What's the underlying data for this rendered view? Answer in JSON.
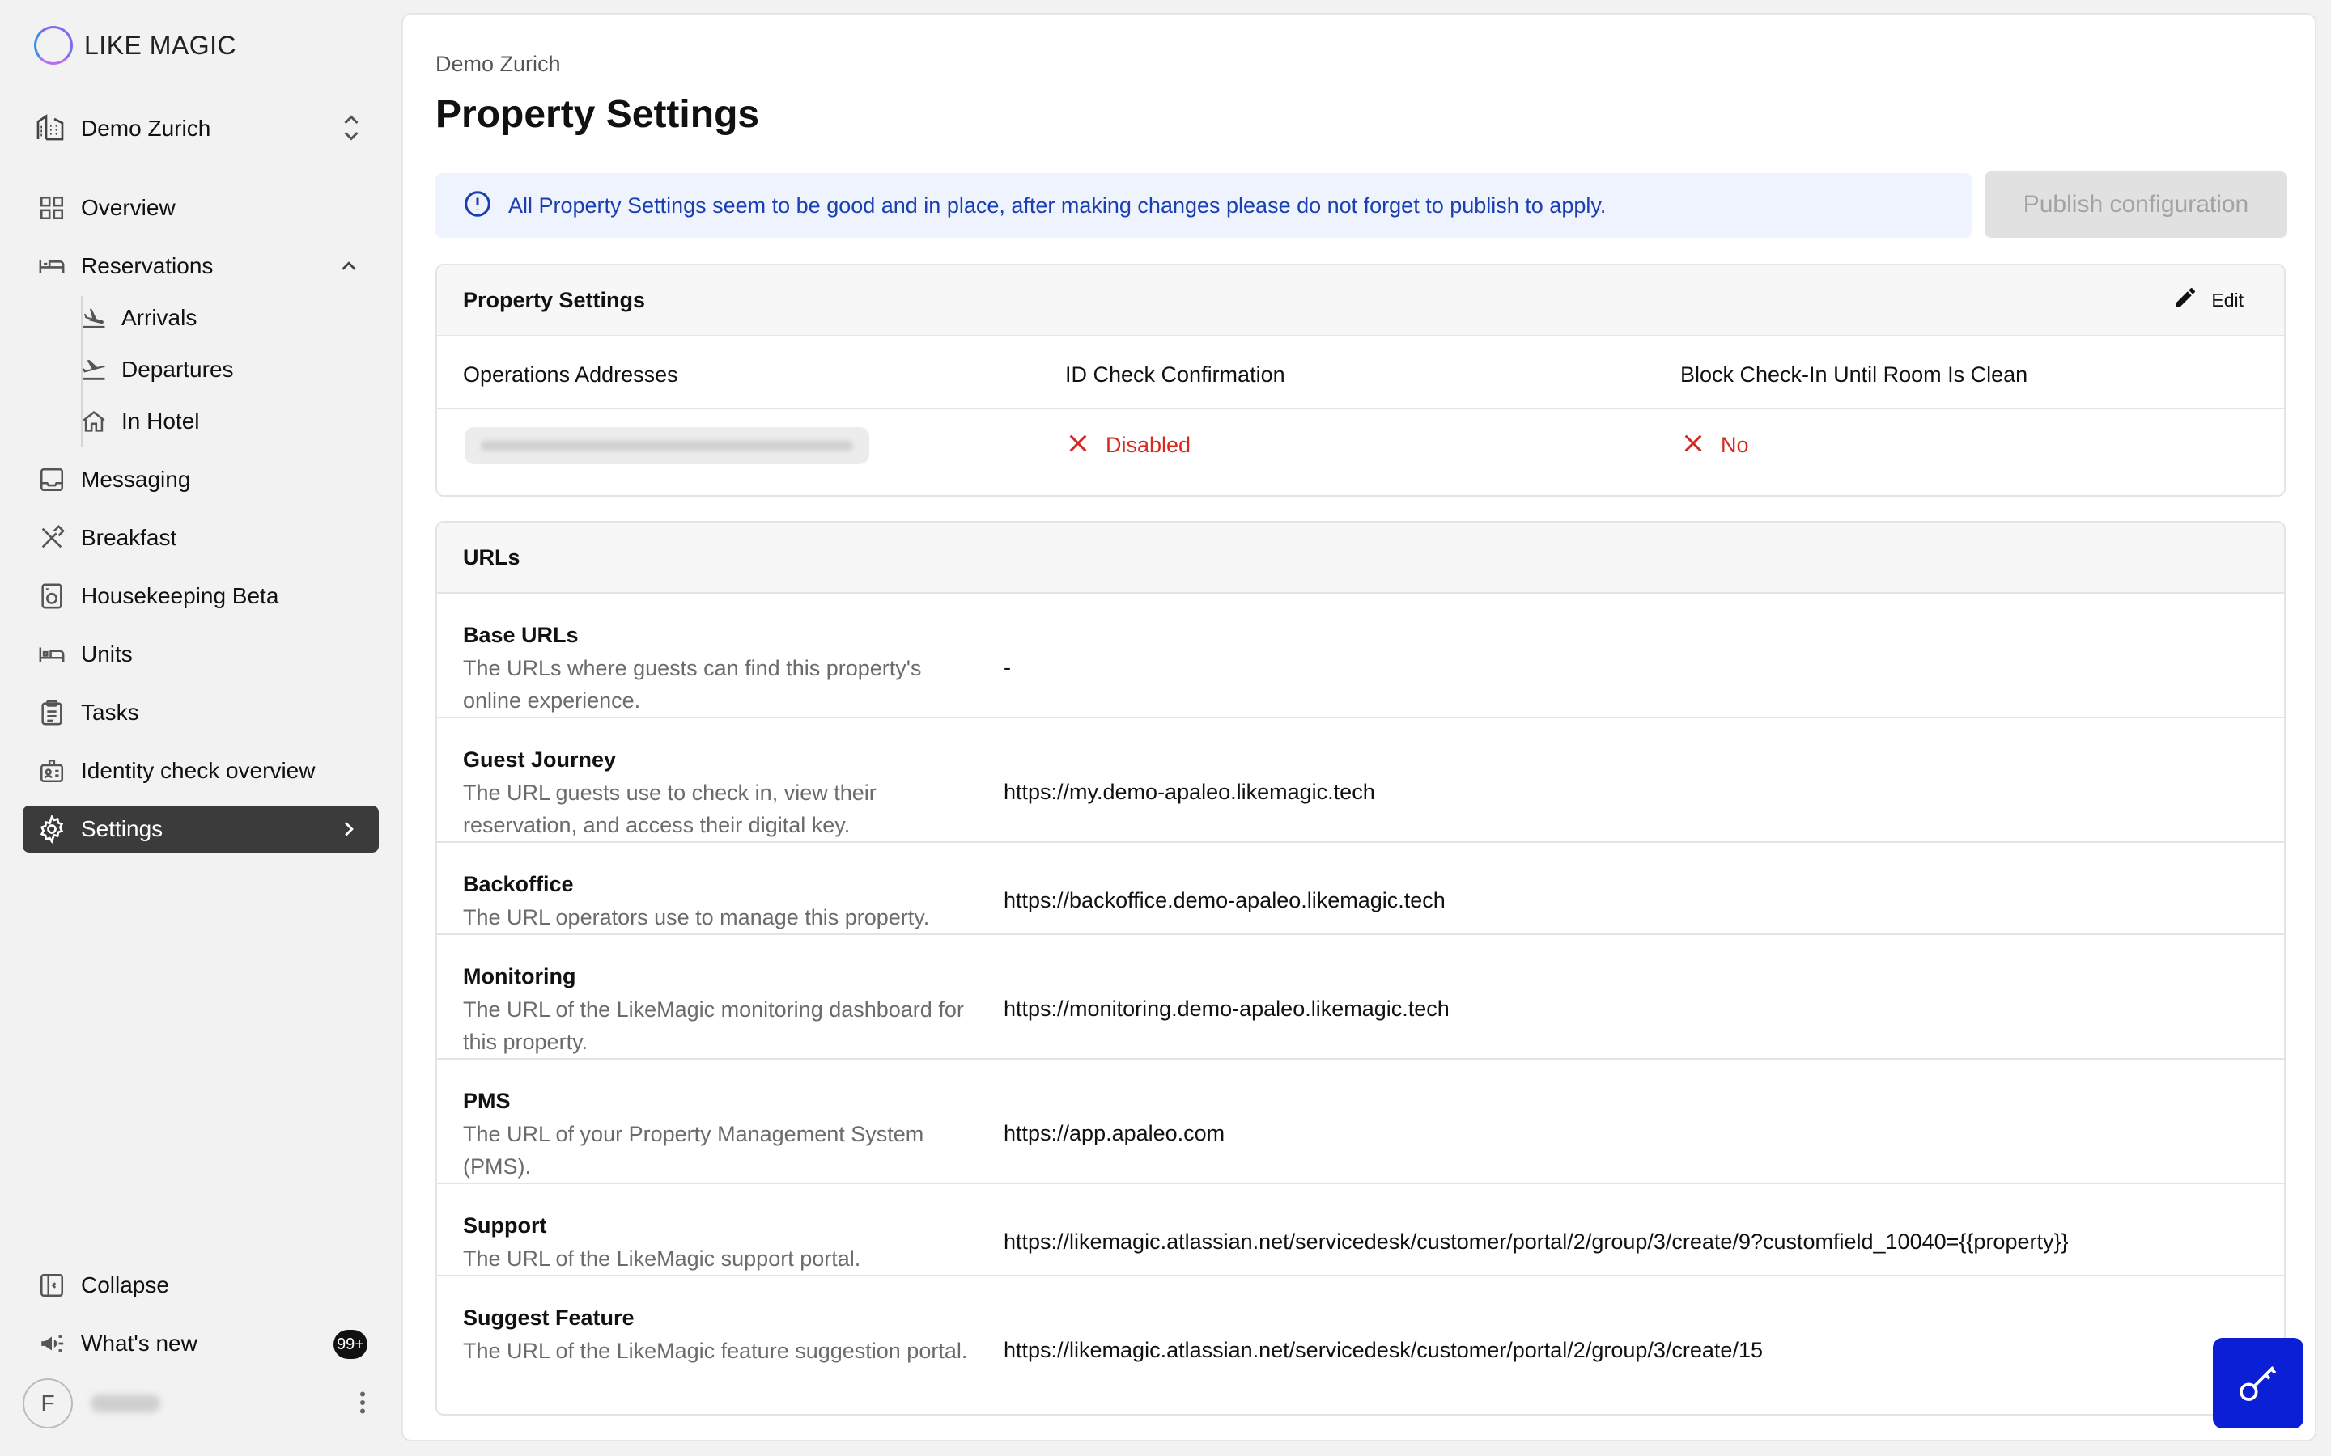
{
  "brand": {
    "name": "LIKE MAGIC"
  },
  "property_switcher": {
    "label": "Demo Zurich"
  },
  "nav": {
    "overview": "Overview",
    "reservations": "Reservations",
    "arrivals": "Arrivals",
    "departures": "Departures",
    "in_hotel": "In Hotel",
    "messaging": "Messaging",
    "breakfast": "Breakfast",
    "housekeeping": "Housekeeping Beta",
    "units": "Units",
    "tasks": "Tasks",
    "identity": "Identity check overview",
    "settings": "Settings"
  },
  "bottom": {
    "collapse": "Collapse",
    "whats_new": "What's new",
    "whats_new_badge": "99+",
    "avatar_initial": "F"
  },
  "page": {
    "breadcrumb": "Demo Zurich",
    "title": "Property Settings",
    "alert": "All Property Settings seem to be good and in place, after making changes please do not forget to publish to apply.",
    "publish_button": "Publish configuration"
  },
  "property_card": {
    "title": "Property Settings",
    "edit_label": "Edit",
    "columns": [
      "Operations Addresses",
      "ID Check Confirmation",
      "Block Check-In Until Room Is Clean"
    ],
    "id_check_value": "Disabled",
    "block_checkin_value": "No",
    "status_color": "#d6281c"
  },
  "urls_card": {
    "title": "URLs",
    "rows": [
      {
        "title": "Base URLs",
        "desc": "The URLs where guests can find this property's online experience.",
        "value": "-"
      },
      {
        "title": "Guest Journey",
        "desc": "The URL guests use to check in, view their reservation, and access their digital key.",
        "value": "https://my.demo-apaleo.likemagic.tech"
      },
      {
        "title": "Backoffice",
        "desc": "The URL operators use to manage this property.",
        "value": "https://backoffice.demo-apaleo.likemagic.tech"
      },
      {
        "title": "Monitoring",
        "desc": "The URL of the LikeMagic monitoring dashboard for this property.",
        "value": "https://monitoring.demo-apaleo.likemagic.tech"
      },
      {
        "title": "PMS",
        "desc": "The URL of your Property Management System (PMS).",
        "value": "https://app.apaleo.com"
      },
      {
        "title": "Support",
        "desc": "The URL of the LikeMagic support portal.",
        "value": "https://likemagic.atlassian.net/servicedesk/customer/portal/2/group/3/create/9?customfield_10040={{property}}"
      },
      {
        "title": "Suggest Feature",
        "desc": "The URL of the LikeMagic feature suggestion portal.",
        "value": "https://likemagic.atlassian.net/servicedesk/customer/portal/2/group/3/create/15"
      }
    ]
  },
  "colors": {
    "accent_blue": "#0b1fd6",
    "alert_text": "#1a3fb0",
    "alert_bg": "#eef3fd",
    "active_nav": "#3b3b3b"
  },
  "fab": {
    "icon": "key-icon"
  }
}
